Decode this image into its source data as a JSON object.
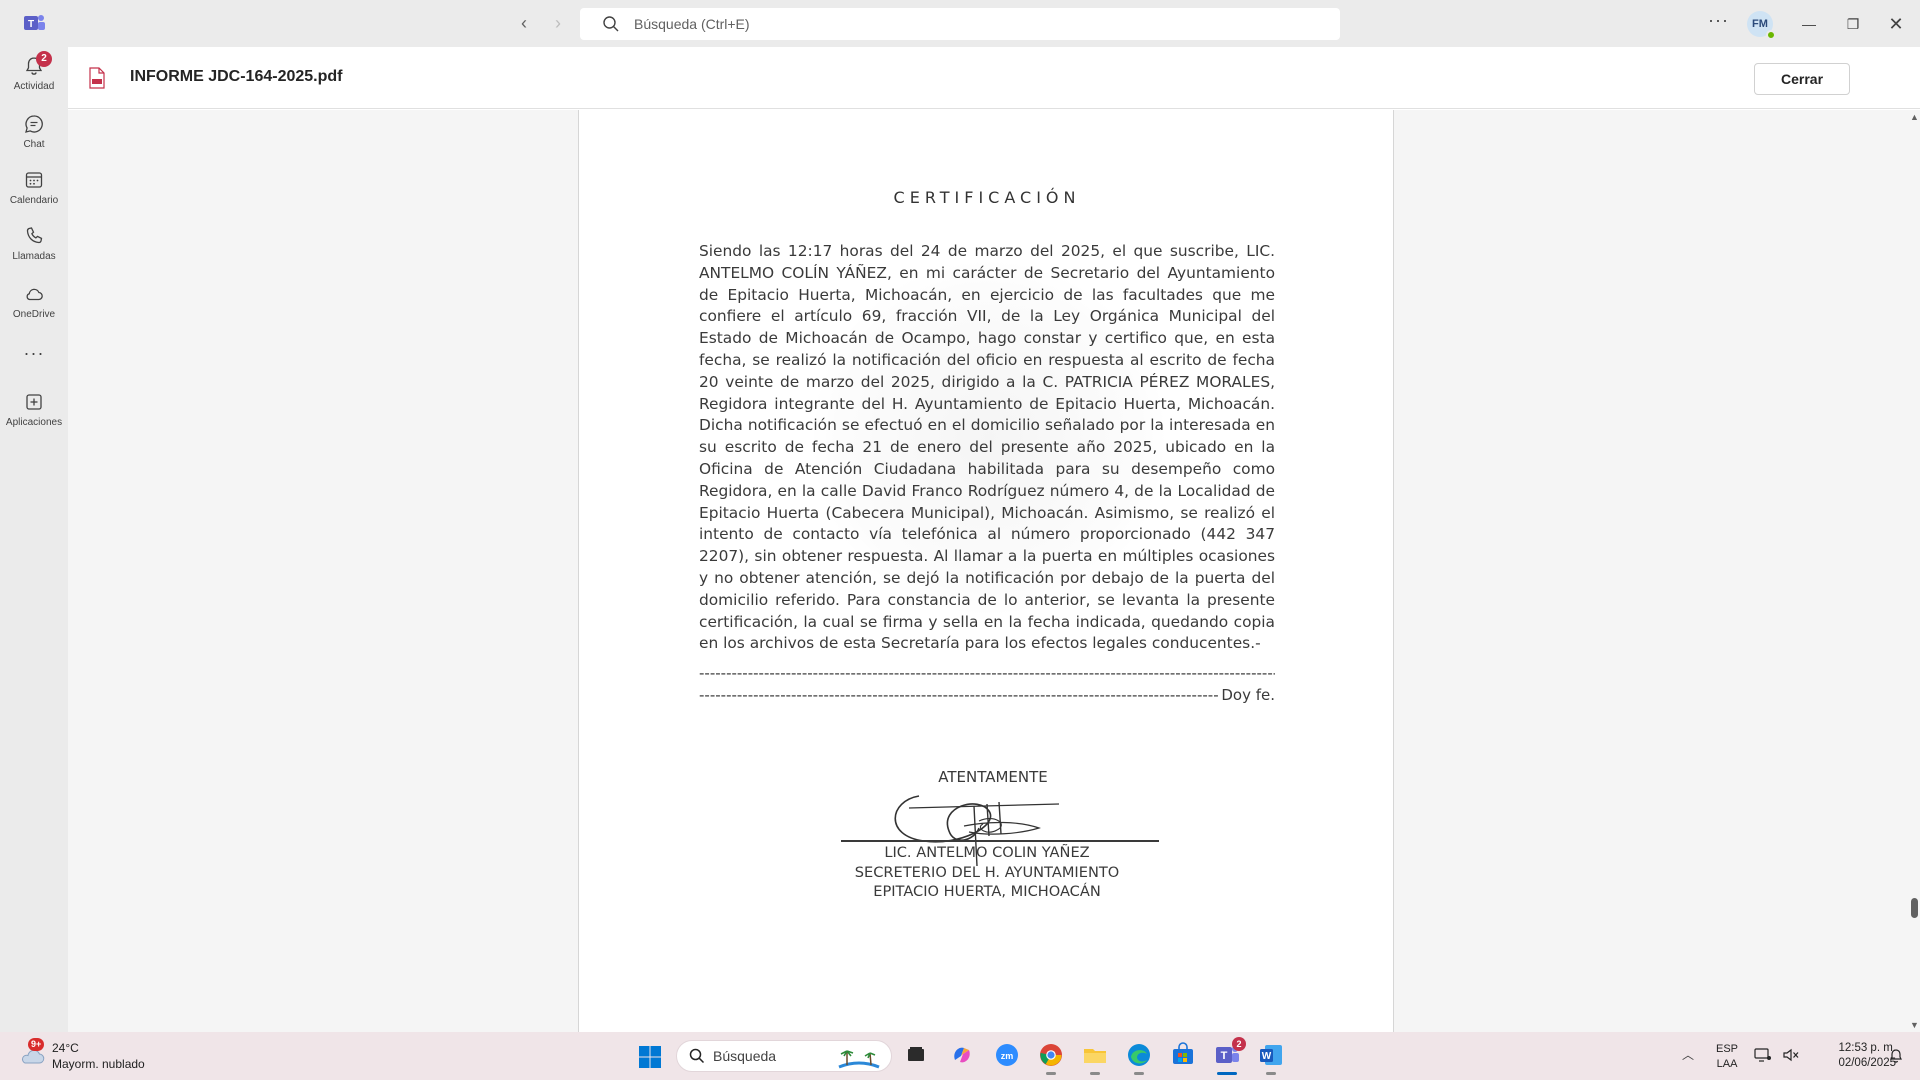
{
  "app": {
    "search_placeholder": "Búsqueda (Ctrl+E)",
    "avatar_initials": "FM",
    "accent": "#5b5fc7"
  },
  "rail": {
    "items": [
      {
        "label": "Actividad",
        "icon": "bell-icon",
        "badge": "2"
      },
      {
        "label": "Chat",
        "icon": "chat-icon"
      },
      {
        "label": "Calendario",
        "icon": "calendar-icon"
      },
      {
        "label": "Llamadas",
        "icon": "phone-icon"
      },
      {
        "label": "OneDrive",
        "icon": "cloud-icon"
      },
      {
        "label": "",
        "icon": "more-icon"
      },
      {
        "label": "Aplicaciones",
        "icon": "add-apps-icon"
      }
    ]
  },
  "file": {
    "name": "INFORME JDC-164-2025.pdf",
    "close_label": "Cerrar"
  },
  "document": {
    "heading": "CERTIFICACIÓN",
    "body": "Siendo las 12:17 horas del 24 de marzo del 2025, el que suscribe, LIC. ANTELMO COLÍN YÁÑEZ, en mi carácter de Secretario del Ayuntamiento de Epitacio Huerta, Michoacán, en ejercicio de las facultades que me confiere el artículo 69, fracción VII, de la Ley Orgánica Municipal del Estado de Michoacán de Ocampo, hago constar y certifico que, en esta fecha, se realizó la notificación del oficio en respuesta al escrito de fecha 20 veinte de marzo del 2025, dirigido a la C. PATRICIA PÉREZ MORALES, Regidora integrante del H. Ayuntamiento de Epitacio Huerta, Michoacán. Dicha notificación se efectuó en el domicilio señalado por la interesada en su escrito de fecha 21 de enero del presente año 2025, ubicado en la Oficina de Atención Ciudadana habilitada para su desempeño como Regidora, en la calle David Franco Rodríguez número 4, de la Localidad de Epitacio Huerta (Cabecera Municipal), Michoacán. Asimismo, se realizó el intento de contacto vía telefónica al número proporcionado (442 347 2207), sin obtener respuesta. Al llamar a la puerta en múltiples ocasiones y no obtener atención, se dejó la notificación por debajo de la puerta del domicilio referido. Para constancia de lo anterior, se levanta la presente certificación, la cual se firma y sella en la fecha indicada, quedando copia en los archivos de esta Secretaría para los efectos legales conducentes.-",
    "dash_line": "-----------------------------------------------------------------------------------------------------------------",
    "dash_line_2": "-----------------------------------------------------------------------------------------------------------------",
    "closing": "Doy fe.",
    "salutation": "ATENTAMENTE",
    "signer_name": "LIC. ANTELMO COLIN YAÑEZ",
    "signer_role": "SECRETERIO DEL H. AYUNTAMIENTO",
    "signer_place": "EPITACIO HUERTA, MICHOACÁN"
  },
  "taskbar": {
    "weather_temp": "24°C",
    "weather_desc": "Mayorm. nublado",
    "weather_badge": "9+",
    "search_label": "Búsqueda",
    "teams_badge": "2",
    "lang_1": "ESP",
    "lang_2": "LAA",
    "time": "12:53 p. m.",
    "date": "02/06/2025"
  }
}
